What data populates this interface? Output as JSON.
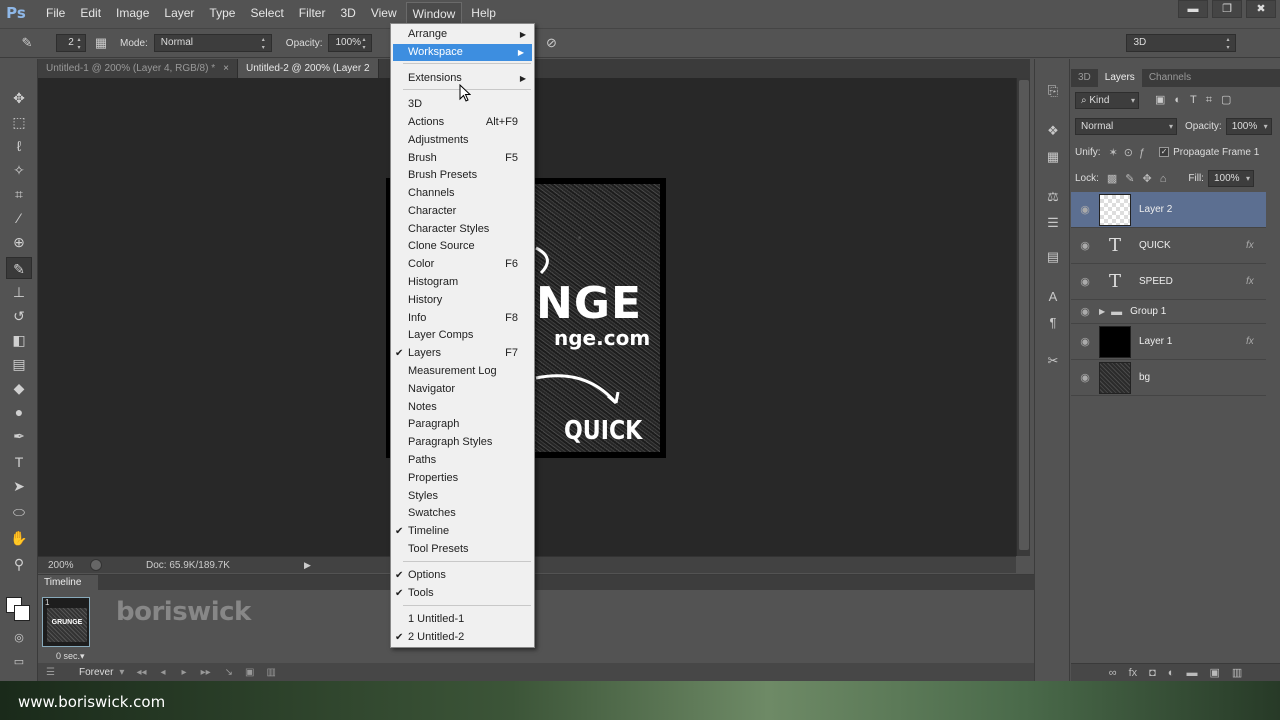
{
  "app": {
    "logo": "Ps"
  },
  "menubar": {
    "items": [
      "File",
      "Edit",
      "Image",
      "Layer",
      "Type",
      "Select",
      "Filter",
      "3D",
      "View",
      "Window",
      "Help"
    ]
  },
  "window_controls": {
    "minimize": "▬",
    "restore": "❐",
    "close": "✖"
  },
  "options": {
    "brush_size": "2",
    "mode_label": "Mode:",
    "mode_value": "Normal",
    "opacity_label": "Opacity:",
    "opacity_value": "100%",
    "workspace_value": "3D"
  },
  "documents": {
    "tabs": [
      {
        "label": "Untitled-1 @ 200% (Layer 4, RGB/8) *",
        "close": "×"
      },
      {
        "label": "Untitled-2 @ 200% (Layer 2",
        "close": ""
      }
    ]
  },
  "canvas": {
    "art_title": "NGE",
    "art_url": "nge.com",
    "art_word": "QUICK"
  },
  "status": {
    "zoom": "200%",
    "doc": "Doc: 65.9K/189.7K",
    "play": "▶"
  },
  "window_menu": {
    "items": [
      {
        "label": "Arrange",
        "shortcut": "",
        "submenu": true,
        "checked": false
      },
      {
        "label": "Workspace",
        "shortcut": "",
        "submenu": true,
        "checked": false,
        "highlighted": true
      },
      {
        "label": "Extensions",
        "shortcut": "",
        "submenu": true,
        "checked": false
      },
      {
        "label": "3D",
        "shortcut": "",
        "submenu": false,
        "checked": false
      },
      {
        "label": "Actions",
        "shortcut": "Alt+F9",
        "submenu": false,
        "checked": false
      },
      {
        "label": "Adjustments",
        "shortcut": "",
        "submenu": false,
        "checked": false
      },
      {
        "label": "Brush",
        "shortcut": "F5",
        "submenu": false,
        "checked": false
      },
      {
        "label": "Brush Presets",
        "shortcut": "",
        "submenu": false,
        "checked": false
      },
      {
        "label": "Channels",
        "shortcut": "",
        "submenu": false,
        "checked": false
      },
      {
        "label": "Character",
        "shortcut": "",
        "submenu": false,
        "checked": false
      },
      {
        "label": "Character Styles",
        "shortcut": "",
        "submenu": false,
        "checked": false
      },
      {
        "label": "Clone Source",
        "shortcut": "",
        "submenu": false,
        "checked": false
      },
      {
        "label": "Color",
        "shortcut": "F6",
        "submenu": false,
        "checked": false
      },
      {
        "label": "Histogram",
        "shortcut": "",
        "submenu": false,
        "checked": false
      },
      {
        "label": "History",
        "shortcut": "",
        "submenu": false,
        "checked": false
      },
      {
        "label": "Info",
        "shortcut": "F8",
        "submenu": false,
        "checked": false
      },
      {
        "label": "Layer Comps",
        "shortcut": "",
        "submenu": false,
        "checked": false
      },
      {
        "label": "Layers",
        "shortcut": "F7",
        "submenu": false,
        "checked": true
      },
      {
        "label": "Measurement Log",
        "shortcut": "",
        "submenu": false,
        "checked": false
      },
      {
        "label": "Navigator",
        "shortcut": "",
        "submenu": false,
        "checked": false
      },
      {
        "label": "Notes",
        "shortcut": "",
        "submenu": false,
        "checked": false
      },
      {
        "label": "Paragraph",
        "shortcut": "",
        "submenu": false,
        "checked": false
      },
      {
        "label": "Paragraph Styles",
        "shortcut": "",
        "submenu": false,
        "checked": false
      },
      {
        "label": "Paths",
        "shortcut": "",
        "submenu": false,
        "checked": false
      },
      {
        "label": "Properties",
        "shortcut": "",
        "submenu": false,
        "checked": false
      },
      {
        "label": "Styles",
        "shortcut": "",
        "submenu": false,
        "checked": false
      },
      {
        "label": "Swatches",
        "shortcut": "",
        "submenu": false,
        "checked": false
      },
      {
        "label": "Timeline",
        "shortcut": "",
        "submenu": false,
        "checked": true
      },
      {
        "label": "Tool Presets",
        "shortcut": "",
        "submenu": false,
        "checked": false
      },
      {
        "label": "Options",
        "shortcut": "",
        "submenu": false,
        "checked": true
      },
      {
        "label": "Tools",
        "shortcut": "",
        "submenu": false,
        "checked": true
      },
      {
        "label": "1 Untitled-1",
        "shortcut": "",
        "submenu": false,
        "checked": false
      },
      {
        "label": "2 Untitled-2",
        "shortcut": "",
        "submenu": false,
        "checked": true
      }
    ]
  },
  "panels": {
    "tabs": [
      "3D",
      "Layers",
      "Channels"
    ],
    "kind_label": "Kind",
    "blend_mode": "Normal",
    "opacity_label": "Opacity:",
    "opacity_value": "100%",
    "unify_label": "Unify:",
    "propagate_label": "Propagate Frame 1",
    "lock_label": "Lock:",
    "fill_label": "Fill:",
    "fill_value": "100%",
    "layers": [
      {
        "name": "Layer 2",
        "type": "pixel",
        "fx": false,
        "selected": true
      },
      {
        "name": "QUICK",
        "type": "text",
        "fx": true,
        "selected": false
      },
      {
        "name": "SPEED",
        "type": "text",
        "fx": true,
        "selected": false
      },
      {
        "name": "Group 1",
        "type": "group",
        "fx": false,
        "selected": false
      },
      {
        "name": "Layer 1",
        "type": "black",
        "fx": true,
        "selected": false
      },
      {
        "name": "bg",
        "type": "texture",
        "fx": false,
        "selected": false
      }
    ],
    "text_thumb": "T",
    "fx_text": "fx",
    "eye": "👁"
  },
  "timeline": {
    "title": "Timeline",
    "frame_number": "1",
    "frame_art": "GRUNGE",
    "frame_delay": "0 sec.▾",
    "loop": "Forever",
    "watermark": "boriswick"
  },
  "footer": {
    "site": "www.boriswick.com"
  },
  "colors": {
    "accent": "#3d8ee0",
    "selected_layer": "#5c6f91",
    "menu_bg": "#f0f0f0"
  }
}
